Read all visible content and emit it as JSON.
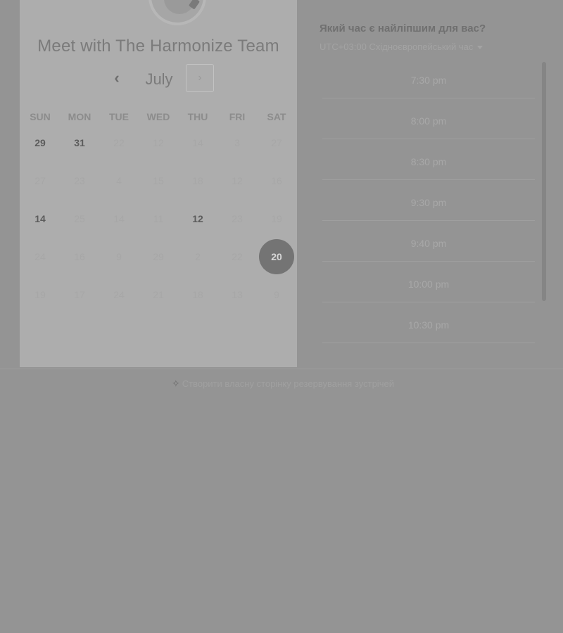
{
  "card": {
    "title": "Meet with The Harmonize Team",
    "month": "July",
    "prev_label": "‹",
    "next_label": "›",
    "weekdays": [
      "SUN",
      "MON",
      "TUE",
      "WED",
      "THU",
      "FRI",
      "SAT"
    ],
    "weeks": [
      [
        {
          "d": "29",
          "s": "active"
        },
        {
          "d": "31",
          "s": "active"
        },
        {
          "d": "22",
          "s": "inactive"
        },
        {
          "d": "12",
          "s": "inactive"
        },
        {
          "d": "14",
          "s": "inactive"
        },
        {
          "d": "3",
          "s": "inactive"
        },
        {
          "d": "27",
          "s": "inactive"
        }
      ],
      [
        {
          "d": "27",
          "s": "inactive"
        },
        {
          "d": "23",
          "s": "inactive"
        },
        {
          "d": "4",
          "s": "inactive"
        },
        {
          "d": "15",
          "s": "inactive"
        },
        {
          "d": "18",
          "s": "inactive"
        },
        {
          "d": "12",
          "s": "inactive"
        },
        {
          "d": "16",
          "s": "inactive"
        }
      ],
      [
        {
          "d": "14",
          "s": "active"
        },
        {
          "d": "25",
          "s": "inactive"
        },
        {
          "d": "14",
          "s": "inactive"
        },
        {
          "d": "11",
          "s": "inactive"
        },
        {
          "d": "12",
          "s": "active"
        },
        {
          "d": "23",
          "s": "inactive"
        },
        {
          "d": "19",
          "s": "inactive"
        }
      ],
      [
        {
          "d": "24",
          "s": "inactive"
        },
        {
          "d": "16",
          "s": "inactive"
        },
        {
          "d": "9",
          "s": "inactive"
        },
        {
          "d": "29",
          "s": "inactive"
        },
        {
          "d": "2",
          "s": "inactive"
        },
        {
          "d": "22",
          "s": "inactive"
        },
        {
          "d": "20",
          "s": "selected"
        }
      ],
      [
        {
          "d": "19",
          "s": "inactive"
        },
        {
          "d": "17",
          "s": "inactive"
        },
        {
          "d": "24",
          "s": "inactive"
        },
        {
          "d": "21",
          "s": "inactive"
        },
        {
          "d": "18",
          "s": "inactive"
        },
        {
          "d": "13",
          "s": "inactive"
        },
        {
          "d": "9",
          "s": "inactive"
        }
      ]
    ]
  },
  "right": {
    "title": "Який час є найліпшим для вас?",
    "timezone": "UTC+03:00 Східноєвропейський час",
    "slots": [
      "7:30 pm",
      "8:00 pm",
      "8:30 pm",
      "9:30 pm",
      "9:40 pm",
      "10:00 pm",
      "10:30 pm"
    ]
  },
  "footer": {
    "link_label": "Створити власну сторінку резервування зустрічей"
  }
}
